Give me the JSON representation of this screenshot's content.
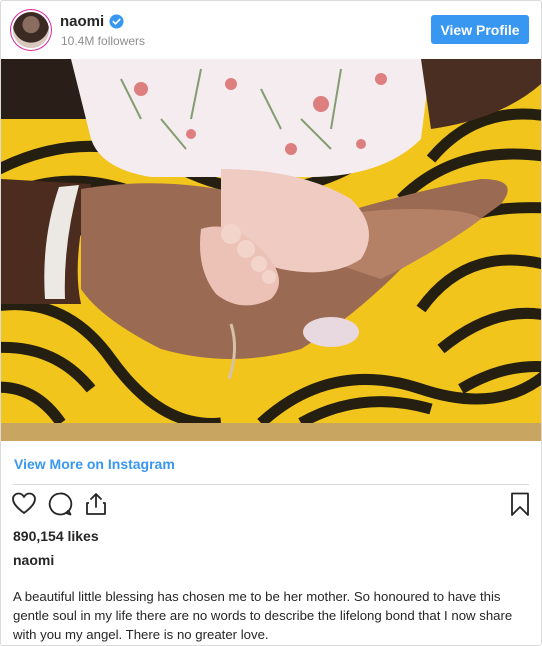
{
  "header": {
    "username": "naomi",
    "followers": "10.4M followers",
    "view_profile_label": "View Profile"
  },
  "post": {
    "view_more_label": "View More on Instagram",
    "likes": "890,154 likes",
    "caption_user": "naomi",
    "caption": "A beautiful little blessing has chosen me to be her mother. So honoured to have this gentle soul in my life there are no words to describe the lifelong bond that I now share with you my angel. There is no greater love."
  },
  "icons": {
    "verified": "verified-badge-icon",
    "like": "heart-icon",
    "comment": "comment-icon",
    "share": "share-icon",
    "save": "bookmark-icon"
  },
  "colors": {
    "accent": "#3897f0",
    "verified": "#3897f0",
    "text": "#262626",
    "muted": "#8e8e8e",
    "border": "#dbdbdb"
  }
}
